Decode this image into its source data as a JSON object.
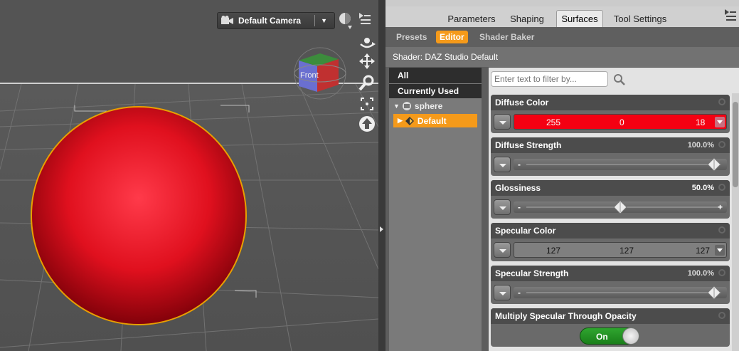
{
  "viewport": {
    "camera_label": "Default Camera",
    "axis_cube_face": "Front",
    "tools": [
      "orbit-icon",
      "pan-icon",
      "zoom-icon",
      "frame-icon",
      "reset-icon"
    ]
  },
  "tabs": [
    "Parameters",
    "Shaping",
    "Surfaces",
    "Tool Settings"
  ],
  "active_tab": "Surfaces",
  "subtabs": [
    "Presets",
    "Editor",
    "Shader Baker"
  ],
  "active_subtab": "Editor",
  "shader_label": "Shader: DAZ Studio Default",
  "tree": {
    "all": "All",
    "currently_used": "Currently Used",
    "node": "sphere",
    "surface": "Default"
  },
  "filter_placeholder": "Enter text to filter by...",
  "properties": {
    "diffuse_color": {
      "label": "Diffuse Color",
      "r": "255",
      "g": "0",
      "b": "18",
      "color": "#f40012"
    },
    "diffuse_strength": {
      "label": "Diffuse Strength",
      "value": "100.0%",
      "level": 1.0
    },
    "glossiness": {
      "label": "Glossiness",
      "value": "50.0%",
      "level": 0.5
    },
    "specular_color": {
      "label": "Specular Color",
      "r": "127",
      "g": "127",
      "b": "127",
      "color": "#7f7f7f"
    },
    "specular_strength": {
      "label": "Specular Strength",
      "value": "100.0%",
      "level": 1.0
    },
    "multiply_specular": {
      "label": "Multiply Specular Through Opacity",
      "toggle": "On"
    }
  },
  "colors": {
    "accent": "#f59a1a",
    "sphere": "#e0101e",
    "toggle_on": "#2a9a2a"
  }
}
